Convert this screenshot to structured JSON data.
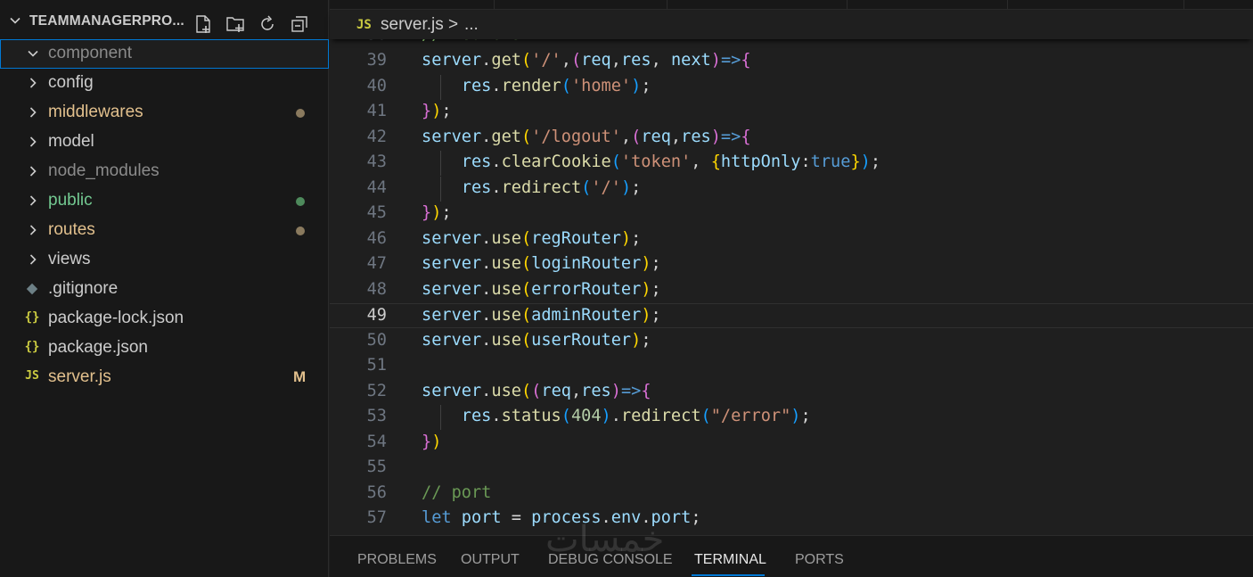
{
  "explorer": {
    "title": "TEAMMANAGERPRO...",
    "items": [
      {
        "label": "component",
        "kind": "folder",
        "expanded": true,
        "color": "#8b8b8b",
        "selected": true
      },
      {
        "label": "config",
        "kind": "folder",
        "color": "#cccccc"
      },
      {
        "label": "middlewares",
        "kind": "folder",
        "color": "#e2c08d",
        "dot": "#8a7a5e"
      },
      {
        "label": "model",
        "kind": "folder",
        "color": "#cccccc"
      },
      {
        "label": "node_modules",
        "kind": "folder",
        "color": "#8b8b8b"
      },
      {
        "label": "public",
        "kind": "folder",
        "color": "#73c991",
        "dot": "#4e8a5c"
      },
      {
        "label": "routes",
        "kind": "folder",
        "color": "#e2c08d",
        "dot": "#8a7a5e"
      },
      {
        "label": "views",
        "kind": "folder",
        "color": "#cccccc"
      },
      {
        "label": ".gitignore",
        "kind": "file",
        "icon": "git-icon",
        "color": "#cccccc"
      },
      {
        "label": "package-lock.json",
        "kind": "file",
        "icon": "json-icon",
        "glyph": "{}",
        "color": "#cccccc"
      },
      {
        "label": "package.json",
        "kind": "file",
        "icon": "json-icon",
        "glyph": "{}",
        "color": "#cccccc"
      },
      {
        "label": "server.js",
        "kind": "file",
        "icon": "js-icon",
        "glyph": "JS",
        "color": "#e2c08d",
        "badge": "M"
      }
    ]
  },
  "breadcrumb": {
    "lang_glyph": "JS",
    "file": "server.js",
    "separator": ">",
    "more": "..."
  },
  "editor": {
    "active_line": 49,
    "lines": [
      {
        "n": 39,
        "tokens": [
          [
            "v",
            "server"
          ],
          [
            "o",
            "."
          ],
          [
            "f",
            "get"
          ],
          [
            "b1",
            "("
          ],
          [
            "s",
            "'/'"
          ],
          [
            "o",
            ","
          ],
          [
            "b2",
            "("
          ],
          [
            "v",
            "req"
          ],
          [
            "o",
            ","
          ],
          [
            "v",
            "res"
          ],
          [
            "o",
            ", "
          ],
          [
            "v",
            "next"
          ],
          [
            "b2",
            ")"
          ],
          [
            "kb",
            "=>"
          ],
          [
            "b2",
            "{"
          ]
        ]
      },
      {
        "n": 40,
        "guide": true,
        "tokens": [
          [
            "o",
            "    "
          ],
          [
            "v",
            "res"
          ],
          [
            "o",
            "."
          ],
          [
            "f",
            "render"
          ],
          [
            "b3",
            "("
          ],
          [
            "s",
            "'home'"
          ],
          [
            "b3",
            ")"
          ],
          [
            "o",
            ";"
          ]
        ]
      },
      {
        "n": 41,
        "tokens": [
          [
            "b2",
            "}"
          ],
          [
            "b1",
            ")"
          ],
          [
            "o",
            ";"
          ]
        ]
      },
      {
        "n": 42,
        "tokens": [
          [
            "v",
            "server"
          ],
          [
            "o",
            "."
          ],
          [
            "f",
            "get"
          ],
          [
            "b1",
            "("
          ],
          [
            "s",
            "'/logout'"
          ],
          [
            "o",
            ","
          ],
          [
            "b2",
            "("
          ],
          [
            "v",
            "req"
          ],
          [
            "o",
            ","
          ],
          [
            "v",
            "res"
          ],
          [
            "b2",
            ")"
          ],
          [
            "kb",
            "=>"
          ],
          [
            "b2",
            "{"
          ]
        ]
      },
      {
        "n": 43,
        "guide": true,
        "tokens": [
          [
            "o",
            "    "
          ],
          [
            "v",
            "res"
          ],
          [
            "o",
            "."
          ],
          [
            "f",
            "clearCookie"
          ],
          [
            "b3",
            "("
          ],
          [
            "s",
            "'token'"
          ],
          [
            "o",
            ", "
          ],
          [
            "b1",
            "{"
          ],
          [
            "v",
            "httpOnly"
          ],
          [
            "o",
            ":"
          ],
          [
            "k",
            "true"
          ],
          [
            "b1",
            "}"
          ],
          [
            "b3",
            ")"
          ],
          [
            "o",
            ";"
          ]
        ]
      },
      {
        "n": 44,
        "guide": true,
        "tokens": [
          [
            "o",
            "    "
          ],
          [
            "v",
            "res"
          ],
          [
            "o",
            "."
          ],
          [
            "f",
            "redirect"
          ],
          [
            "b3",
            "("
          ],
          [
            "s",
            "'/'"
          ],
          [
            "b3",
            ")"
          ],
          [
            "o",
            ";"
          ]
        ]
      },
      {
        "n": 45,
        "tokens": [
          [
            "b2",
            "}"
          ],
          [
            "b1",
            ")"
          ],
          [
            "o",
            ";"
          ]
        ]
      },
      {
        "n": 46,
        "tokens": [
          [
            "v",
            "server"
          ],
          [
            "o",
            "."
          ],
          [
            "f",
            "use"
          ],
          [
            "b1",
            "("
          ],
          [
            "v",
            "regRouter"
          ],
          [
            "b1",
            ")"
          ],
          [
            "o",
            ";"
          ]
        ]
      },
      {
        "n": 47,
        "tokens": [
          [
            "v",
            "server"
          ],
          [
            "o",
            "."
          ],
          [
            "f",
            "use"
          ],
          [
            "b1",
            "("
          ],
          [
            "v",
            "loginRouter"
          ],
          [
            "b1",
            ")"
          ],
          [
            "o",
            ";"
          ]
        ]
      },
      {
        "n": 48,
        "tokens": [
          [
            "v",
            "server"
          ],
          [
            "o",
            "."
          ],
          [
            "f",
            "use"
          ],
          [
            "b1",
            "("
          ],
          [
            "v",
            "errorRouter"
          ],
          [
            "b1",
            ")"
          ],
          [
            "o",
            ";"
          ]
        ]
      },
      {
        "n": 49,
        "tokens": [
          [
            "v",
            "server"
          ],
          [
            "o",
            "."
          ],
          [
            "f",
            "use"
          ],
          [
            "b1",
            "("
          ],
          [
            "v",
            "adminRouter"
          ],
          [
            "b1",
            ")"
          ],
          [
            "o",
            ";"
          ]
        ]
      },
      {
        "n": 50,
        "tokens": [
          [
            "v",
            "server"
          ],
          [
            "o",
            "."
          ],
          [
            "f",
            "use"
          ],
          [
            "b1",
            "("
          ],
          [
            "v",
            "userRouter"
          ],
          [
            "b1",
            ")"
          ],
          [
            "o",
            ";"
          ]
        ]
      },
      {
        "n": 51,
        "tokens": []
      },
      {
        "n": 52,
        "tokens": [
          [
            "v",
            "server"
          ],
          [
            "o",
            "."
          ],
          [
            "f",
            "use"
          ],
          [
            "b1",
            "("
          ],
          [
            "b2",
            "("
          ],
          [
            "v",
            "req"
          ],
          [
            "o",
            ","
          ],
          [
            "v",
            "res"
          ],
          [
            "b2",
            ")"
          ],
          [
            "kb",
            "=>"
          ],
          [
            "b2",
            "{"
          ]
        ]
      },
      {
        "n": 53,
        "guide": true,
        "tokens": [
          [
            "o",
            "    "
          ],
          [
            "v",
            "res"
          ],
          [
            "o",
            "."
          ],
          [
            "f",
            "status"
          ],
          [
            "b3",
            "("
          ],
          [
            "n",
            "404"
          ],
          [
            "b3",
            ")"
          ],
          [
            "o",
            "."
          ],
          [
            "f",
            "redirect"
          ],
          [
            "b3",
            "("
          ],
          [
            "s",
            "\"/error\""
          ],
          [
            "b3",
            ")"
          ],
          [
            "o",
            ";"
          ]
        ]
      },
      {
        "n": 54,
        "tokens": [
          [
            "b2",
            "}"
          ],
          [
            "b1",
            ")"
          ]
        ]
      },
      {
        "n": 55,
        "tokens": []
      },
      {
        "n": 56,
        "tokens": [
          [
            "c",
            "// port"
          ]
        ]
      },
      {
        "n": 57,
        "tokens": [
          [
            "k",
            "let"
          ],
          [
            "o",
            " "
          ],
          [
            "v",
            "port"
          ],
          [
            "o",
            " = "
          ],
          [
            "v",
            "process"
          ],
          [
            "o",
            "."
          ],
          [
            "v",
            "env"
          ],
          [
            "o",
            "."
          ],
          [
            "v",
            "port"
          ],
          [
            "o",
            ";"
          ]
        ]
      }
    ]
  },
  "panel": {
    "tabs": [
      "PROBLEMS",
      "OUTPUT",
      "DEBUG CONSOLE",
      "TERMINAL",
      "PORTS"
    ],
    "active": "TERMINAL"
  },
  "watermark": "خمسات"
}
